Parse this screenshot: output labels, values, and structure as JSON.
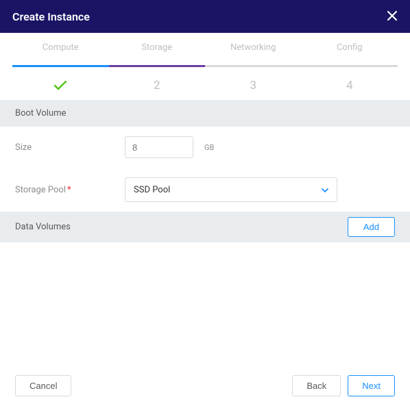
{
  "header": {
    "title": "Create Instance"
  },
  "steps": [
    {
      "label": "Compute",
      "indicator": "check"
    },
    {
      "label": "Storage",
      "indicator": "2"
    },
    {
      "label": "Networking",
      "indicator": "3"
    },
    {
      "label": "Config",
      "indicator": "4"
    }
  ],
  "sections": {
    "boot_volume": {
      "title": "Boot Volume",
      "size_label": "Size",
      "size_value": "8",
      "size_unit": "GB",
      "storage_pool_label": "Storage Pool",
      "storage_pool_value": "SSD Pool"
    },
    "data_volumes": {
      "title": "Data Volumes",
      "add_label": "Add"
    }
  },
  "footer": {
    "cancel_label": "Cancel",
    "back_label": "Back",
    "next_label": "Next"
  }
}
